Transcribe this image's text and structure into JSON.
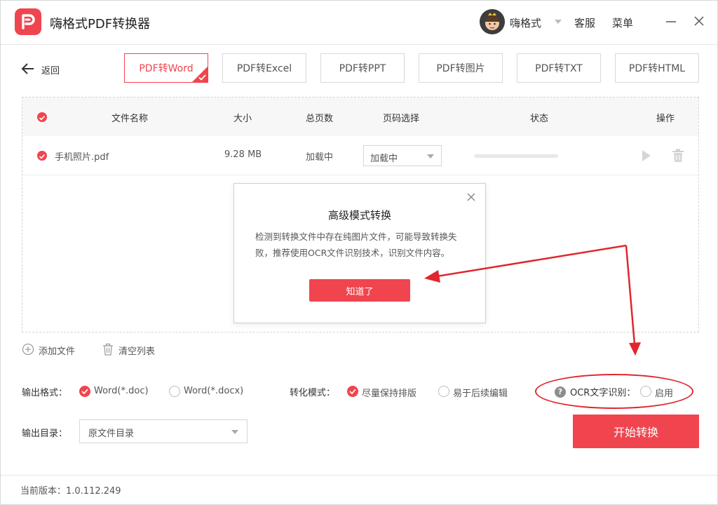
{
  "app": {
    "title": "嗨格式PDF转换器"
  },
  "header": {
    "user_name": "嗨格式",
    "service_label": "客服",
    "menu_label": "菜单"
  },
  "nav": {
    "back_label": "返回"
  },
  "tabs": [
    {
      "label": "PDF转Word",
      "active": true
    },
    {
      "label": "PDF转Excel",
      "active": false
    },
    {
      "label": "PDF转PPT",
      "active": false
    },
    {
      "label": "PDF转图片",
      "active": false
    },
    {
      "label": "PDF转TXT",
      "active": false
    },
    {
      "label": "PDF转HTML",
      "active": false
    }
  ],
  "table": {
    "headers": {
      "name": "文件名称",
      "size": "大小",
      "pages": "总页数",
      "page_select": "页码选择",
      "status": "状态",
      "actions": "操作"
    },
    "rows": [
      {
        "name": "手机照片.pdf",
        "size": "9.28 MB",
        "pages": "加载中",
        "page_select": "加载中",
        "progress": 0
      }
    ]
  },
  "dialog": {
    "title": "高级模式转换",
    "message": "检测到转换文件中存在纯图片文件，可能导致转换失败，推荐使用OCR文件识别技术，识别文件内容。",
    "ok_label": "知道了"
  },
  "actions": {
    "add_file": "添加文件",
    "clear_list": "清空列表"
  },
  "options": {
    "output_format_label": "输出格式：",
    "format_doc": "Word(*.doc)",
    "format_docx": "Word(*.docx)",
    "mode_label": "转化模式：",
    "mode_keep_layout": "尽量保持排版",
    "mode_easy_edit": "易于后续编辑",
    "ocr_label": "OCR文字识别：",
    "ocr_enable": "启用",
    "output_dir_label": "输出目录：",
    "output_dir_value": "原文件目录"
  },
  "start_label": "开始转换",
  "footer": {
    "version_text": "当前版本：1.0.112.249"
  },
  "colors": {
    "accent": "#f0454e",
    "annotation": "#e0262e"
  }
}
